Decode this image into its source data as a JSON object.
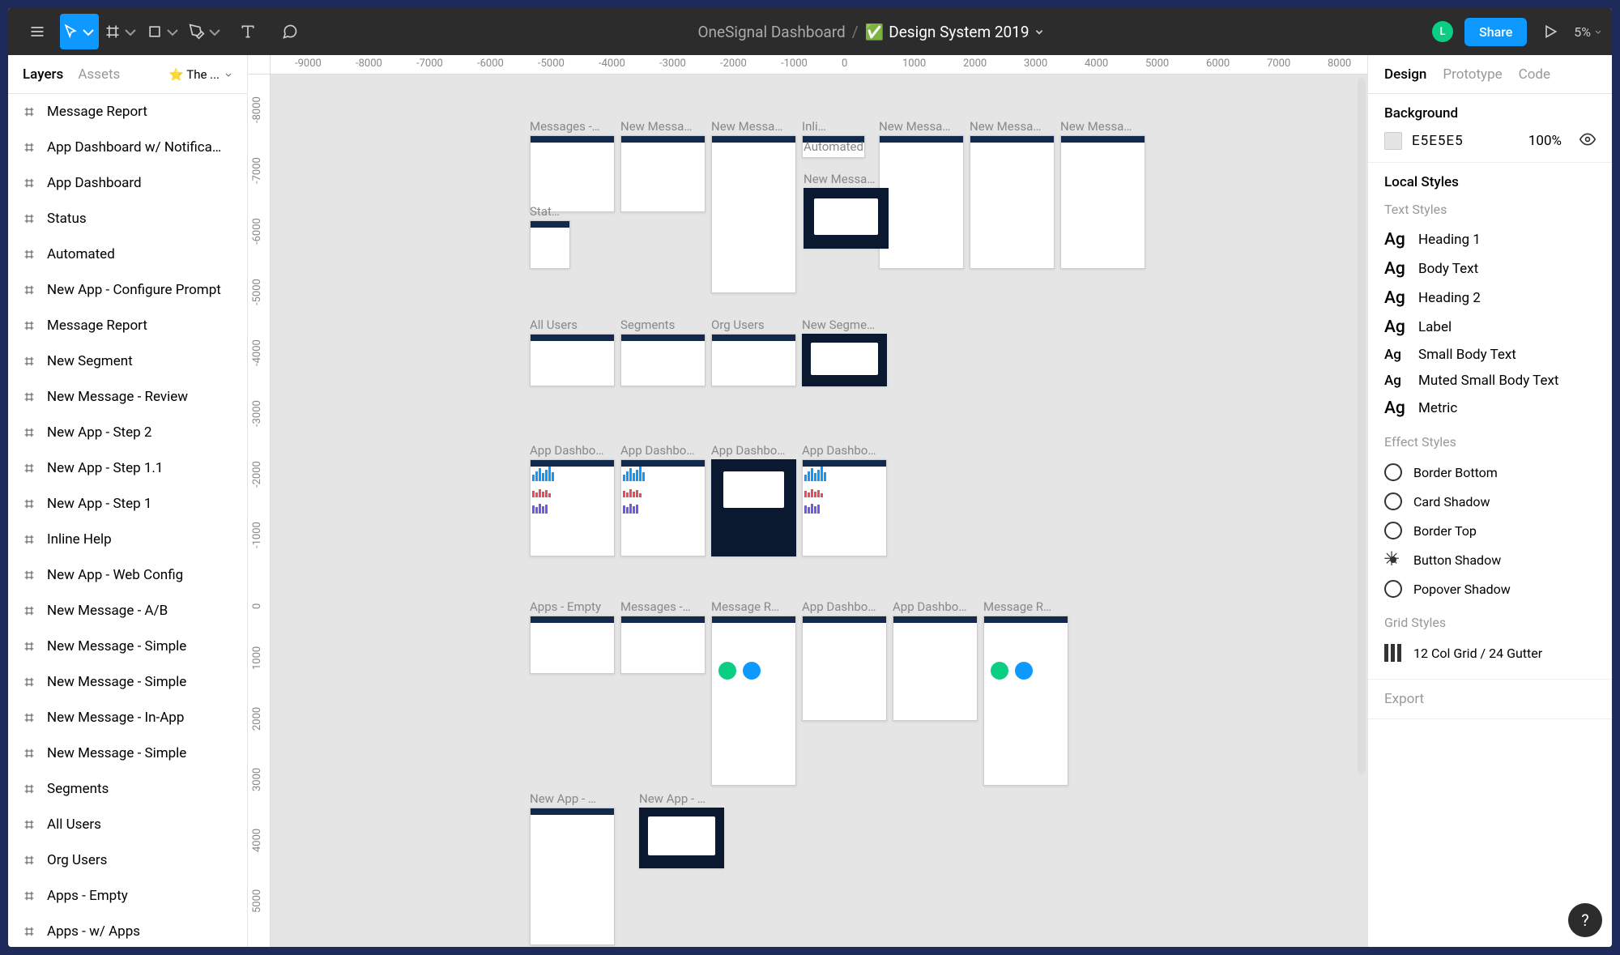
{
  "toolbar": {
    "breadcrumb_org": "OneSignal Dashboard",
    "breadcrumb_sep": "/",
    "breadcrumb_file_prefix": "✅",
    "breadcrumb_file": "Design System 2019",
    "avatar_initial": "L",
    "share_label": "Share",
    "zoom": "5%"
  },
  "left": {
    "tabs": [
      "Layers",
      "Assets"
    ],
    "page_name": "⭐ The ...",
    "layers": [
      "Message Report",
      "App Dashboard w/ Notifica…",
      "App Dashboard",
      "Status",
      "Automated",
      "New App - Configure Prompt",
      "Message Report",
      " New Segment",
      "New Message - Review",
      "New App - Step 2",
      "New App - Step 1.1",
      "New App - Step 1",
      "Inline Help",
      "New App - Web Config",
      "New Message - A/B",
      "New Message - Simple",
      "New Message - Simple",
      "New Message - In-App",
      "New Message - Simple",
      "Segments",
      "All Users",
      "Org Users",
      "Apps - Empty",
      "Apps - w/ Apps"
    ]
  },
  "canvas": {
    "h_ticks": [
      "-9000",
      "-8000",
      "-7000",
      "-6000",
      "-5000",
      "-4000",
      "-3000",
      "-2000",
      "-1000",
      "0",
      "1000",
      "2000",
      "3000",
      "4000",
      "5000",
      "6000",
      "7000",
      "8000"
    ],
    "v_ticks": [
      "-8000",
      "-7000",
      "-6000",
      "-5000",
      "-4000",
      "-3000",
      "-2000",
      "-1000",
      "0",
      "1000",
      "2000",
      "3000",
      "4000",
      "5000"
    ],
    "row1": [
      "Messages -…",
      "New Messa…",
      "New Messa…",
      "Inli…",
      "",
      "New Messa…",
      "New Messa…",
      "New Messa…"
    ],
    "row1b": [
      "Stat…",
      "",
      "",
      "Automated",
      "New Messa…"
    ],
    "row2": [
      "All Users",
      "Segments",
      "Org Users",
      "New Segme…"
    ],
    "row3": [
      "App Dashbo…",
      "App Dashbo…",
      "App Dashbo…",
      "App Dashbo…"
    ],
    "row4": [
      "Apps - Empty",
      "Messages -…",
      "Message R…",
      "App Dashbo…",
      "App Dashbo…",
      "Message R…"
    ],
    "row5": [
      "New App - …",
      "New App - …"
    ]
  },
  "right": {
    "tabs": [
      "Design",
      "Prototype",
      "Code"
    ],
    "bg_title": "Background",
    "bg_hex": "E5E5E5",
    "bg_opacity": "100%",
    "local_styles_title": "Local Styles",
    "text_styles_title": "Text Styles",
    "text_styles": [
      {
        "ag": "Ag",
        "name": "Heading 1",
        "small": false
      },
      {
        "ag": "Ag",
        "name": "Body Text",
        "small": false
      },
      {
        "ag": "Ag",
        "name": "Heading 2",
        "small": false
      },
      {
        "ag": "Ag",
        "name": "Label",
        "small": false
      },
      {
        "ag": "Ag",
        "name": "Small Body Text",
        "small": true
      },
      {
        "ag": "Ag",
        "name": "Muted Small Body Text",
        "small": true
      },
      {
        "ag": "Ag",
        "name": "Metric",
        "small": false
      }
    ],
    "effect_styles_title": "Effect Styles",
    "effect_styles": [
      "Border Bottom",
      "Card Shadow",
      "Border Top",
      "Button Shadow",
      "Popover Shadow"
    ],
    "grid_styles_title": "Grid Styles",
    "grid_style": "12 Col Grid / 24 Gutter",
    "export_title": "Export"
  },
  "help": "?"
}
